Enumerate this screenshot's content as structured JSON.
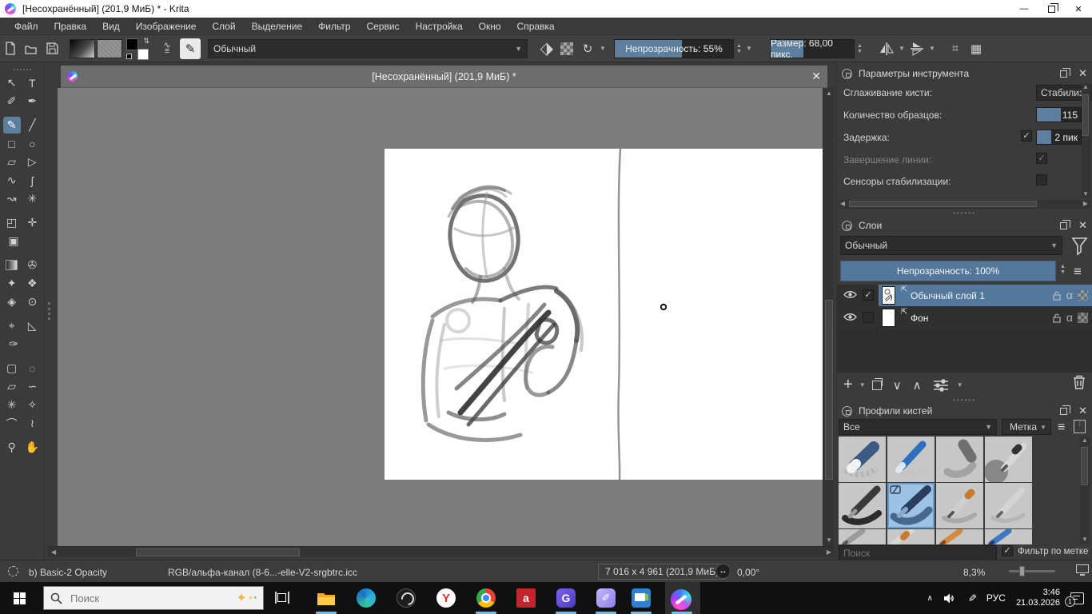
{
  "window": {
    "title": "[Несохранённый]  (201,9 МиБ) * - Krita"
  },
  "menu": {
    "items": [
      "Файл",
      "Правка",
      "Вид",
      "Изображение",
      "Слой",
      "Выделение",
      "Фильтр",
      "Сервис",
      "Настройка",
      "Окно",
      "Справка"
    ]
  },
  "toolbar": {
    "blend_mode": "Обычный",
    "opacity_label": "Непрозрачность: 55%",
    "opacity_fill": "57%",
    "size_label": "Размер: 68,00 пикс.",
    "size_fill": "39%"
  },
  "canvas": {
    "tab_title": "[Несохранённый]  (201,9 МиБ) *"
  },
  "tool_options": {
    "title": "Параметры инструмента",
    "smoothing_label": "Сглаживание кисти:",
    "smoothing_value": "Стабилиза",
    "samples_label": "Количество образцов:",
    "samples_value": "115",
    "samples_fill": "55%",
    "delay_label": "Задержка:",
    "delay_value": "2 пик",
    "delay_fill": "33%",
    "finish_label": "Завершение линии:",
    "sensors_label": "Сенсоры стабилизации:"
  },
  "layers": {
    "title": "Слои",
    "blend_mode": "Обычный",
    "opacity_label": "Непрозрачность:  100%",
    "opacity_fill": "100%",
    "items": [
      {
        "name": "Обычный слой 1"
      },
      {
        "name": "Фон"
      }
    ]
  },
  "brush_presets": {
    "title": "Профили кистей",
    "filter_value": "Все",
    "tag_label": "Метка",
    "search_placeholder": "Поиск",
    "tag_filter_label": "Фильтр по метке"
  },
  "statusbar": {
    "brush_name": "b) Basic-2 Opacity",
    "color_profile": "RGB/альфа-канал (8-6...-elle-V2-srgbtrc.icc",
    "dimensions": "7 016 x 4 961 (201,9 МиБ)",
    "rotation": "0,00°",
    "zoom": "8,3%",
    "zoom_slider_pos": "22%"
  },
  "taskbar": {
    "search_placeholder": "Поиск",
    "tray": {
      "lang": "РУС",
      "time": "3:46",
      "date": "21.03.2026",
      "notification_count": "1"
    }
  }
}
